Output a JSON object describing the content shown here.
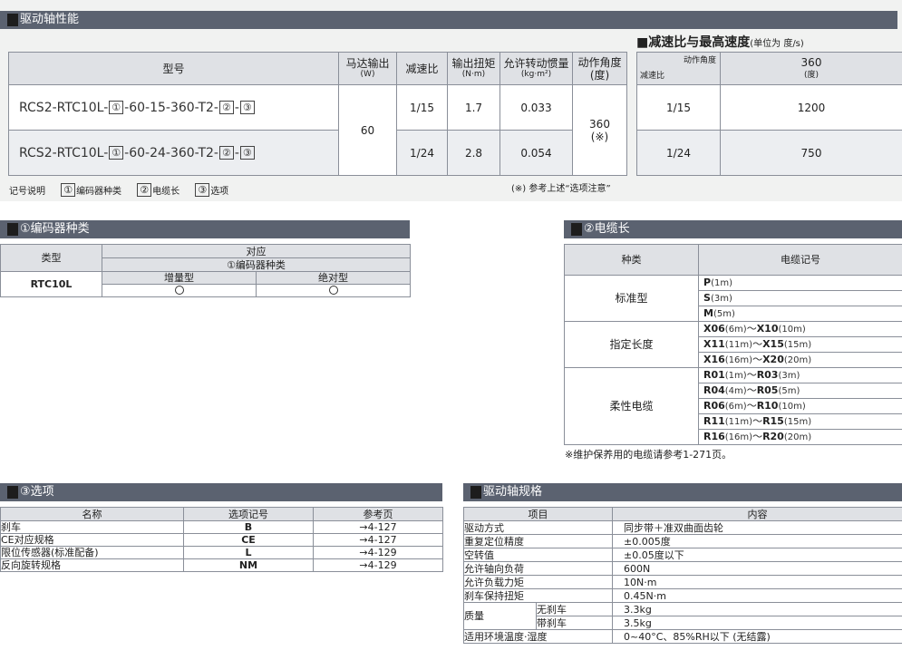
{
  "drive_section": {
    "title": "驱动轴性能",
    "headers": {
      "model": "型号",
      "motor_output": "马达输出",
      "motor_output_unit": "(W)",
      "reduction_ratio": "减速比",
      "output_torque": "输出扭矩",
      "output_torque_unit": "(N·m)",
      "inertia": "允许转动惯量",
      "inertia_unit": "(kg·m²)",
      "angle": "动作角度",
      "angle_unit": "(度)"
    },
    "rows": [
      {
        "model_prefix": "RCS2-RTC10L-",
        "mark1": "①",
        "model_mid": "-60-15-360-T2-",
        "mark2": "②",
        "dash": "-",
        "mark3": "③",
        "ratio": "1/15",
        "torque": "1.7",
        "inertia": "0.033"
      },
      {
        "model_prefix": "RCS2-RTC10L-",
        "mark1": "①",
        "model_mid": "-60-24-360-T2-",
        "mark2": "②",
        "dash": "-",
        "mark3": "③",
        "ratio": "1/24",
        "torque": "2.8",
        "inertia": "0.054"
      }
    ],
    "motor_output_value": "60",
    "angle_value": "360",
    "angle_note": "(※)",
    "legend": {
      "label": "记号说明",
      "mark1": "①",
      "text1": "编码器种类",
      "mark2": "②",
      "text2": "电缆长",
      "mark3": "③",
      "text3": "选项"
    },
    "footnote": "(※) 参考上述“选项注意”"
  },
  "speed_section": {
    "title": "■减速比与最高速度",
    "unit": "(单位为 度/s)",
    "diag_top": "动作角度",
    "diag_bottom": "减速比",
    "col_header": "360",
    "col_unit": "(度)",
    "rows": [
      {
        "ratio": "1/15",
        "speed": "1200"
      },
      {
        "ratio": "1/24",
        "speed": "750"
      }
    ]
  },
  "encoder_section": {
    "title": "①编码器种类",
    "type_header": "类型",
    "support_header": "对应",
    "encoder_header": "①编码器种类",
    "incremental": "增量型",
    "absolute": "绝对型",
    "row_name": "RTC10L"
  },
  "cable_section": {
    "title": "②电缆长",
    "kind_header": "种类",
    "code_header": "电缆记号",
    "groups": [
      {
        "name": "标准型",
        "items": [
          {
            "a": "P",
            "a_len": "(1m)",
            "b": "",
            "b_len": ""
          },
          {
            "a": "S",
            "a_len": "(3m)",
            "b": "",
            "b_len": ""
          },
          {
            "a": "M",
            "a_len": "(5m)",
            "b": "",
            "b_len": ""
          }
        ]
      },
      {
        "name": "指定长度",
        "items": [
          {
            "a": "X06",
            "a_len": "(6m)",
            "b": "X10",
            "b_len": "(10m)"
          },
          {
            "a": "X11",
            "a_len": "(11m)",
            "b": "X15",
            "b_len": "(15m)"
          },
          {
            "a": "X16",
            "a_len": "(16m)",
            "b": "X20",
            "b_len": "(20m)"
          }
        ]
      },
      {
        "name": "柔性电缆",
        "items": [
          {
            "a": "R01",
            "a_len": "(1m)",
            "b": "R03",
            "b_len": "(3m)"
          },
          {
            "a": "R04",
            "a_len": "(4m)",
            "b": "R05",
            "b_len": "(5m)"
          },
          {
            "a": "R06",
            "a_len": "(6m)",
            "b": "R10",
            "b_len": "(10m)"
          },
          {
            "a": "R11",
            "a_len": "(11m)",
            "b": "R15",
            "b_len": "(15m)"
          },
          {
            "a": "R16",
            "a_len": "(16m)",
            "b": "R20",
            "b_len": "(20m)"
          }
        ]
      }
    ],
    "range_sep": "～",
    "note": "※维护保养用的电缆请参考1-271页。"
  },
  "options_section": {
    "title": "③选项",
    "headers": {
      "name": "名称",
      "code": "选项记号",
      "page": "参考页"
    },
    "rows": [
      {
        "name": "刹车",
        "code": "B",
        "page": "→4-127"
      },
      {
        "name": "CE对应规格",
        "code": "CE",
        "page": "→4-127"
      },
      {
        "name": "限位传感器(标准配备)",
        "code": "L",
        "page": "→4-129"
      },
      {
        "name": "反向旋转规格",
        "code": "NM",
        "page": "→4-129"
      }
    ]
  },
  "spec_section": {
    "title": "驱动轴规格",
    "headers": {
      "item": "项目",
      "content": "内容"
    },
    "rows": [
      {
        "item": "驱动方式",
        "content": "同步带＋准双曲面齿轮"
      },
      {
        "item": "重复定位精度",
        "content": "±0.005度"
      },
      {
        "item": "空转值",
        "content": "±0.05度以下"
      },
      {
        "item": "允许轴向负荷",
        "content": "600N"
      },
      {
        "item": "允许负载力矩",
        "content": "10N·m"
      },
      {
        "item": "刹车保持扭矩",
        "content": "0.45N·m"
      }
    ],
    "mass": {
      "item": "质量",
      "no_brake": "无刹车",
      "no_brake_val": "3.3kg",
      "with_brake": "带刹车",
      "with_brake_val": "3.5kg"
    },
    "env": {
      "item": "适用环境温度·湿度",
      "content": "0~40°C、85%RH以下 (无结露)"
    }
  }
}
